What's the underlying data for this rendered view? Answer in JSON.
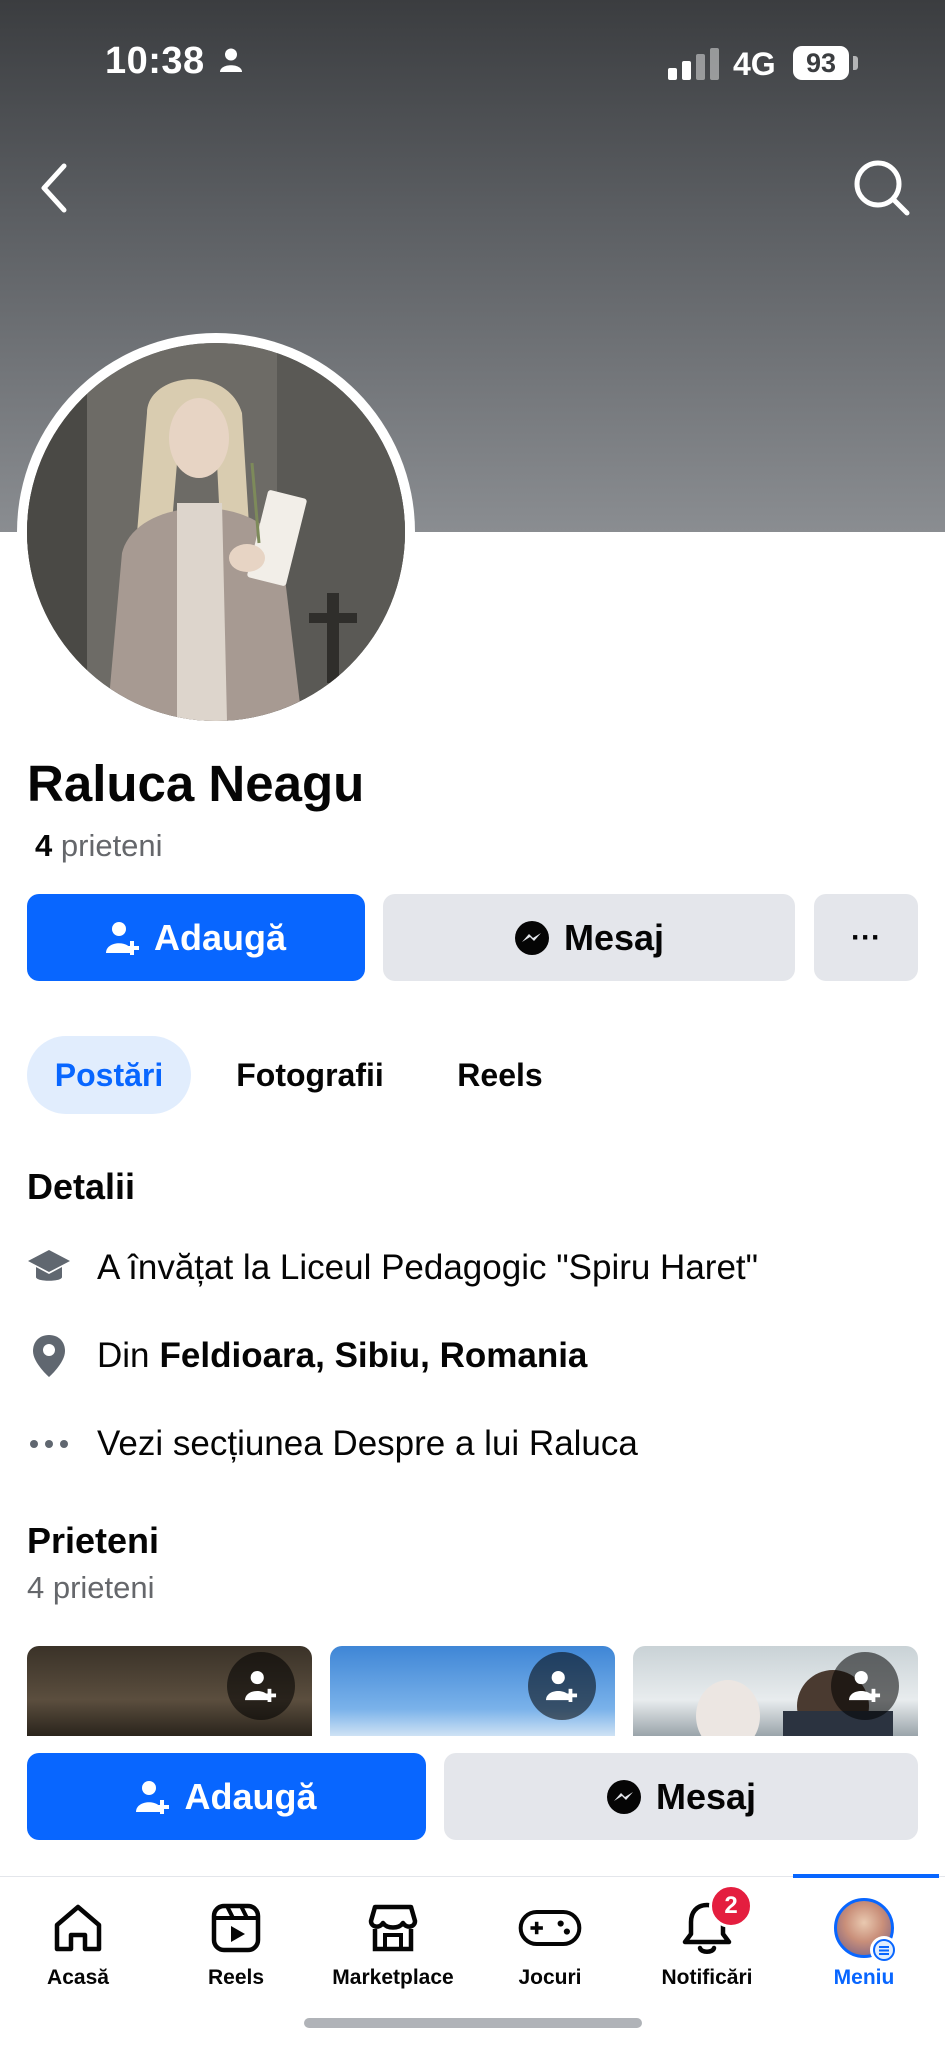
{
  "status_bar": {
    "time": "10:38",
    "network": "4G",
    "battery": "93"
  },
  "profile": {
    "name": "Raluca Neagu",
    "friends_count": "4",
    "friends_word": "prieteni"
  },
  "actions": {
    "add_label": "Adaugă",
    "message_label": "Mesaj",
    "more_label": "···"
  },
  "tabs": [
    {
      "label": "Postări",
      "active": true
    },
    {
      "label": "Fotografii",
      "active": false
    },
    {
      "label": "Reels",
      "active": false
    }
  ],
  "details": {
    "title": "Detalii",
    "education": "A învățat la Liceul Pedagogic \"Spiru Haret\"",
    "from_prefix": "Din",
    "from_place": "Feldioara, Sibiu, Romania",
    "about_link": "Vezi secțiunea Despre a lui Raluca"
  },
  "friends_section": {
    "title": "Prieteni",
    "subtitle": "4 prieteni"
  },
  "sticky_actions": {
    "add_label": "Adaugă",
    "message_label": "Mesaj"
  },
  "nav": {
    "items": [
      {
        "label": "Acasă",
        "icon": "home-icon"
      },
      {
        "label": "Reels",
        "icon": "reels-icon"
      },
      {
        "label": "Marketplace",
        "icon": "marketplace-icon"
      },
      {
        "label": "Jocuri",
        "icon": "gaming-icon"
      },
      {
        "label": "Notificări",
        "icon": "bell-icon",
        "badge": "2"
      },
      {
        "label": "Meniu",
        "icon": "menu-avatar-icon",
        "active": true
      }
    ]
  },
  "colors": {
    "accent": "#0866ff",
    "grey_button": "#e4e6eb",
    "badge": "#e41e3f",
    "tab_active_bg": "#e1edfd"
  }
}
